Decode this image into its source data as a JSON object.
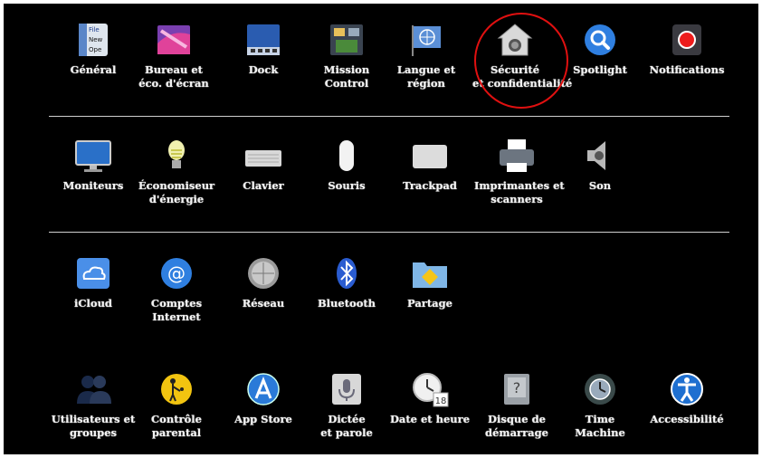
{
  "rows": [
    [
      {
        "id": "general",
        "line1": "Général",
        "line2": "",
        "icon": "general-icon"
      },
      {
        "id": "desktop",
        "line1": "Bureau et",
        "line2": "éco. d'écran",
        "icon": "desktop-screensaver-icon"
      },
      {
        "id": "dock",
        "line1": "Dock",
        "line2": "",
        "icon": "dock-icon"
      },
      {
        "id": "mission",
        "line1": "Mission",
        "line2": "Control",
        "icon": "mission-control-icon"
      },
      {
        "id": "language",
        "line1": "Langue et",
        "line2": "région",
        "icon": "language-region-icon"
      },
      {
        "id": "security",
        "line1": "Sécurité",
        "line2": "et confidentialité",
        "icon": "security-privacy-icon"
      },
      {
        "id": "spotlight",
        "line1": "Spotlight",
        "line2": "",
        "icon": "spotlight-icon"
      },
      {
        "id": "notifications",
        "line1": "Notifications",
        "line2": "",
        "icon": "notifications-icon"
      }
    ],
    [
      {
        "id": "displays",
        "line1": "Moniteurs",
        "line2": "",
        "icon": "monitor-icon"
      },
      {
        "id": "energy",
        "line1": "Économiseur",
        "line2": "d'énergie",
        "icon": "energy-saver-icon"
      },
      {
        "id": "keyboard",
        "line1": "Clavier",
        "line2": "",
        "icon": "keyboard-icon"
      },
      {
        "id": "mouse",
        "line1": "Souris",
        "line2": "",
        "icon": "mouse-icon"
      },
      {
        "id": "trackpad",
        "line1": "Trackpad",
        "line2": "",
        "icon": "trackpad-icon"
      },
      {
        "id": "printers",
        "line1": "Imprimantes et",
        "line2": "scanners",
        "icon": "printer-icon"
      },
      {
        "id": "sound",
        "line1": "Son",
        "line2": "",
        "icon": "speaker-icon"
      }
    ],
    [
      {
        "id": "icloud",
        "line1": "iCloud",
        "line2": "",
        "icon": "icloud-icon"
      },
      {
        "id": "accounts",
        "line1": "Comptes",
        "line2": "Internet",
        "icon": "internet-accounts-icon"
      },
      {
        "id": "network",
        "line1": "Réseau",
        "line2": "",
        "icon": "network-icon"
      },
      {
        "id": "bluetooth",
        "line1": "Bluetooth",
        "line2": "",
        "icon": "bluetooth-icon"
      },
      {
        "id": "sharing",
        "line1": "Partage",
        "line2": "",
        "icon": "sharing-folder-icon"
      }
    ],
    [
      {
        "id": "users",
        "line1": "Utilisateurs et",
        "line2": "groupes",
        "icon": "users-groups-icon"
      },
      {
        "id": "parental",
        "line1": "Contrôle",
        "line2": "parental",
        "icon": "parental-controls-icon"
      },
      {
        "id": "appstore",
        "line1": "App Store",
        "line2": "",
        "icon": "app-store-icon"
      },
      {
        "id": "dictation",
        "line1": "Dictée",
        "line2": "et parole",
        "icon": "dictation-speech-icon"
      },
      {
        "id": "datetime",
        "line1": "Date et heure",
        "line2": "",
        "icon": "date-time-icon",
        "badge": "18"
      },
      {
        "id": "startup",
        "line1": "Disque de",
        "line2": "démarrage",
        "icon": "startup-disk-icon"
      },
      {
        "id": "timemachine",
        "line1": "Time",
        "line2": "Machine",
        "icon": "time-machine-icon"
      },
      {
        "id": "accessibility",
        "line1": "Accessibilité",
        "line2": "",
        "icon": "accessibility-icon"
      }
    ]
  ],
  "general_icon_text": [
    "File",
    "New",
    "Ope"
  ],
  "colors": {
    "background": "#000000",
    "label": "#f2f2f2",
    "divider": "#cfcfcf",
    "highlight": "#e01010"
  }
}
